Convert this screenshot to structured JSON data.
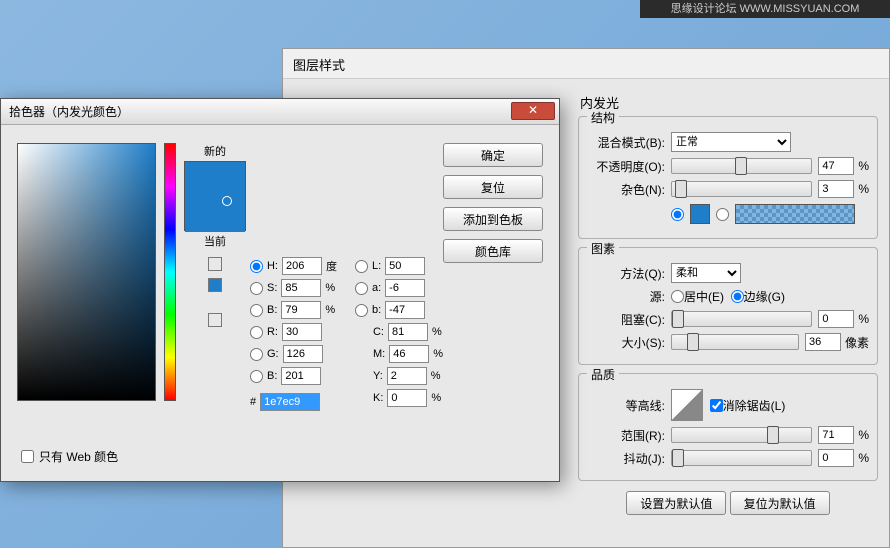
{
  "topbar": {
    "text": "思缘设计论坛  WWW.MISSYUAN.COM"
  },
  "layer": {
    "title": "图层样式",
    "panel_name": "内发光",
    "sect_struct": "结构",
    "blend_label": "混合模式(B):",
    "blend_value": "正常",
    "opacity_label": "不透明度(O):",
    "opacity_value": "47",
    "noise_label": "杂色(N):",
    "noise_value": "3",
    "pct": "%",
    "sect_elem": "图素",
    "method_label": "方法(Q):",
    "method_value": "柔和",
    "source_label": "源:",
    "source_center": "居中(E)",
    "source_edge": "边缘(G)",
    "choke_label": "阻塞(C):",
    "choke_value": "0",
    "size_label": "大小(S):",
    "size_value": "36",
    "px": "像素",
    "sect_quality": "品质",
    "contour_label": "等高线:",
    "antialias": "消除锯齿(L)",
    "range_label": "范围(R):",
    "range_value": "71",
    "jitter_label": "抖动(J):",
    "jitter_value": "0",
    "btn_default": "设置为默认值",
    "btn_reset": "复位为默认值"
  },
  "picker": {
    "title": "拾色器（内发光颜色）",
    "new_label": "新的",
    "current_label": "当前",
    "btn_ok": "确定",
    "btn_cancel": "复位",
    "btn_add": "添加到色板",
    "btn_lib": "颜色库",
    "h_label": "H:",
    "h_value": "206",
    "h_unit": "度",
    "s_label": "S:",
    "s_value": "85",
    "s_unit": "%",
    "bb_label": "B:",
    "bb_value": "79",
    "bb_unit": "%",
    "r_label": "R:",
    "r_value": "30",
    "g_label": "G:",
    "g_value": "126",
    "b_label": "B:",
    "b_value": "201",
    "l_label": "L:",
    "l_value": "50",
    "a_label": "a:",
    "a_value": "-6",
    "lab_b_label": "b:",
    "lab_b_value": "-47",
    "c_label": "C:",
    "c_value": "81",
    "m_label": "M:",
    "m_value": "46",
    "y_label": "Y:",
    "y_value": "2",
    "k_label": "K:",
    "k_value": "0",
    "hex_label": "#",
    "hex_value": "1e7ec9",
    "web_only": "只有 Web 颜色"
  }
}
